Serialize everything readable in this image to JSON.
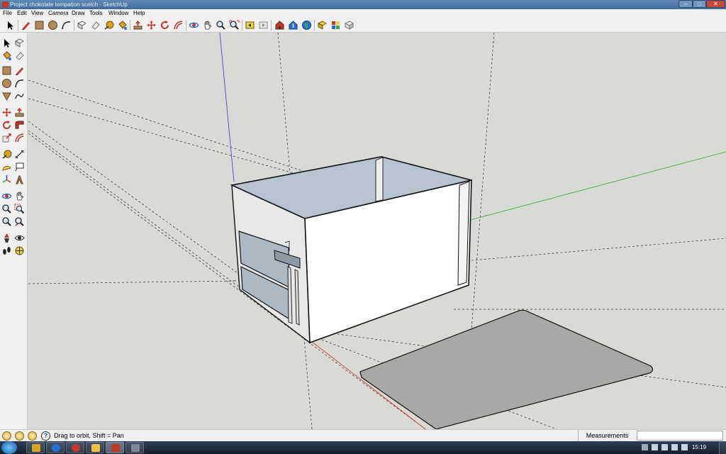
{
  "window": {
    "title": "Project chokolate tempation scetch - SketchUp"
  },
  "menu": [
    "File",
    "Edit",
    "View",
    "Camera",
    "Draw",
    "Tools",
    "Window",
    "Help"
  ],
  "status": {
    "message": "Drag to orbit.  Shift = Pan",
    "measurements_label": "Measurements",
    "measurements_value": ""
  },
  "taskbar": {
    "clock": "15:19"
  },
  "colors": {
    "axis_red": "#c0392b",
    "axis_green": "#2eaa2e",
    "axis_blue": "#3a3acc",
    "viewport_bg": "#d9d9d5"
  }
}
